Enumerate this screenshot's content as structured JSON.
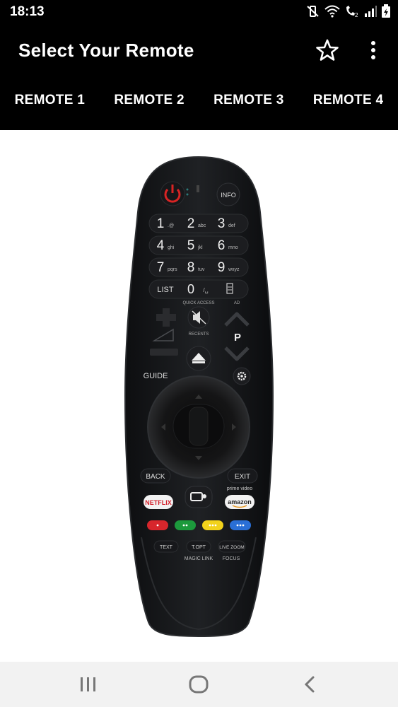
{
  "status": {
    "time": "18:13",
    "icons": [
      "mute-vibrate-icon",
      "wifi-icon",
      "volte-call-icon",
      "signal-icon",
      "battery-icon"
    ]
  },
  "appbar": {
    "title": "Select Your Remote",
    "star_icon": "star-outline-icon",
    "menu_icon": "more-vert-icon"
  },
  "tabs": [
    {
      "label": "REMOTE 1"
    },
    {
      "label": "REMOTE 2"
    },
    {
      "label": "REMOTE 3"
    },
    {
      "label": "REMOTE 4"
    }
  ],
  "remote": {
    "info": "INFO",
    "keys": [
      {
        "digit": "1",
        "sub": ".@"
      },
      {
        "digit": "2",
        "sub": "abc"
      },
      {
        "digit": "3",
        "sub": "def"
      },
      {
        "digit": "4",
        "sub": "ghi"
      },
      {
        "digit": "5",
        "sub": "jkl"
      },
      {
        "digit": "6",
        "sub": "mno"
      },
      {
        "digit": "7",
        "sub": "pqrs"
      },
      {
        "digit": "8",
        "sub": "tuv"
      },
      {
        "digit": "9",
        "sub": "wxyz"
      }
    ],
    "list": "LIST",
    "zero": "0",
    "zero_sub": "/␣",
    "quick_access": "QUICK ACCESS",
    "ad": "AD",
    "recents": "RECENTS",
    "p": "P",
    "guide": "GUIDE",
    "back": "BACK",
    "exit": "EXIT",
    "prime_video": "prime video",
    "netflix": "NETFLIX",
    "amazon": "amazon",
    "text": "TEXT",
    "topt": "T.OPT",
    "live_zoom": "LIVE ZOOM",
    "magic_link": "MAGIC LINK",
    "focus": "FOCUS",
    "colors": [
      "#d7262c",
      "#1c9a3c",
      "#f2d21b",
      "#2a6fd6"
    ]
  },
  "navbar": {
    "recents_icon": "recent-apps-icon",
    "home_icon": "home-icon",
    "back_icon": "back-icon"
  }
}
